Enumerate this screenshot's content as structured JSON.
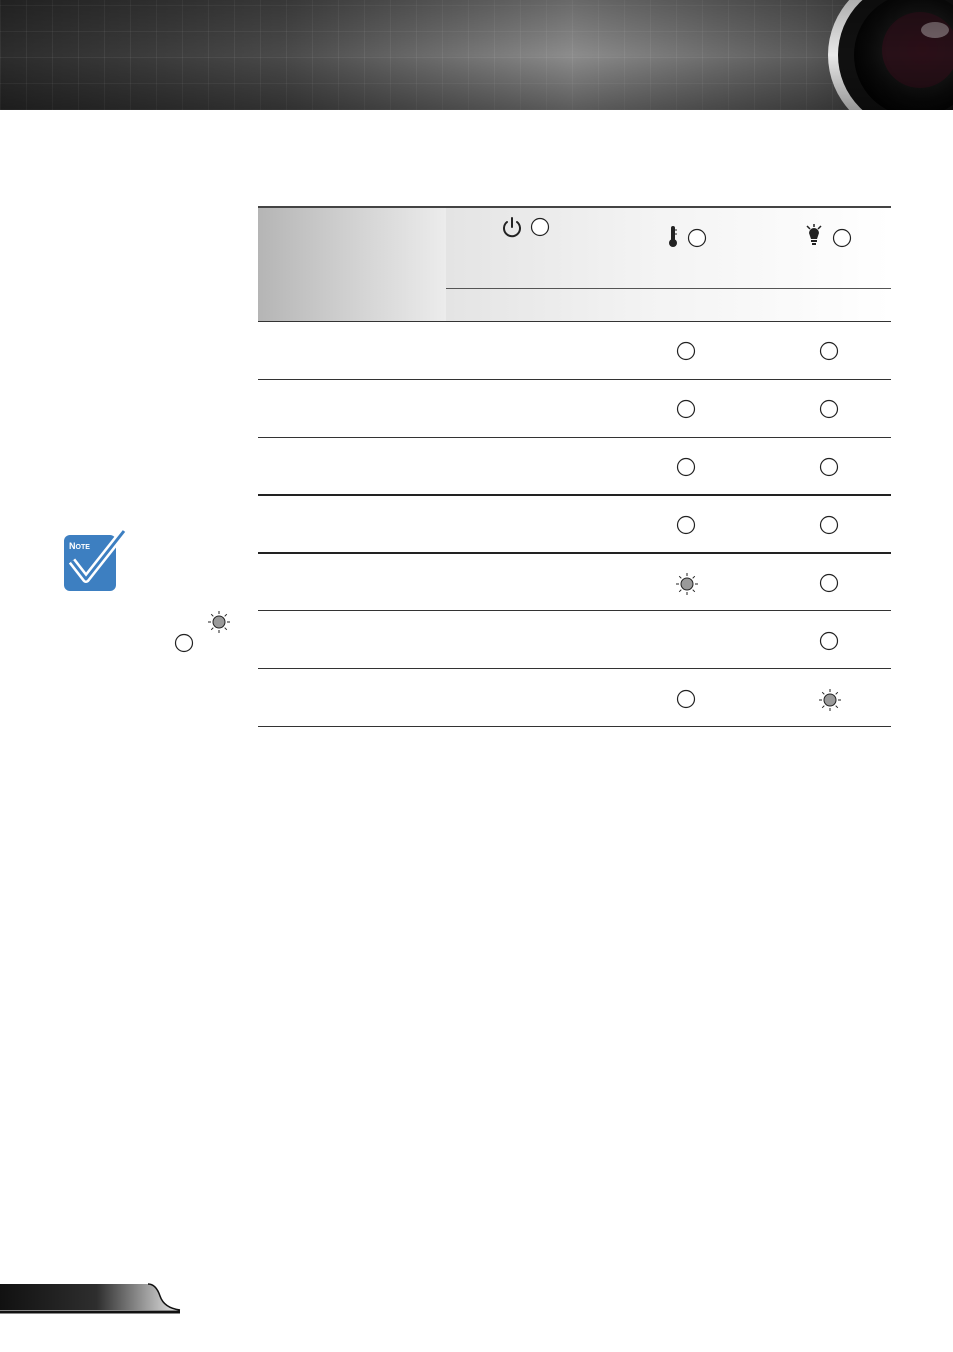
{
  "header": {
    "banner_icon": "projector-lens-icon"
  },
  "table": {
    "columns": [
      {
        "icon": "power-icon",
        "indicator": "led-off"
      },
      {
        "icon": "thermometer-icon",
        "indicator": "led-off"
      },
      {
        "icon": "lamp-icon",
        "indicator": "led-off"
      }
    ],
    "rows": [
      {
        "temp_led": "off",
        "lamp_led": "off"
      },
      {
        "temp_led": "off",
        "lamp_led": "off"
      },
      {
        "temp_led": "off",
        "lamp_led": "off"
      },
      {
        "temp_led": "off",
        "lamp_led": "off"
      },
      {
        "temp_led": "flashing",
        "lamp_led": "off"
      },
      {
        "temp_led": "",
        "lamp_led": "off"
      },
      {
        "temp_led": "off",
        "lamp_led": "flashing"
      }
    ]
  },
  "note": {
    "icon": "note-check-icon",
    "label": "Note",
    "legend": [
      {
        "icon": "led-flashing-icon"
      },
      {
        "icon": "led-off-icon"
      }
    ]
  },
  "footer": {
    "page_tab_icon": "page-tab"
  },
  "colors": {
    "note_blue": "#3d7fc1",
    "led_fill": "#9a9a9a",
    "banner_dark": "#2c2c2c"
  }
}
